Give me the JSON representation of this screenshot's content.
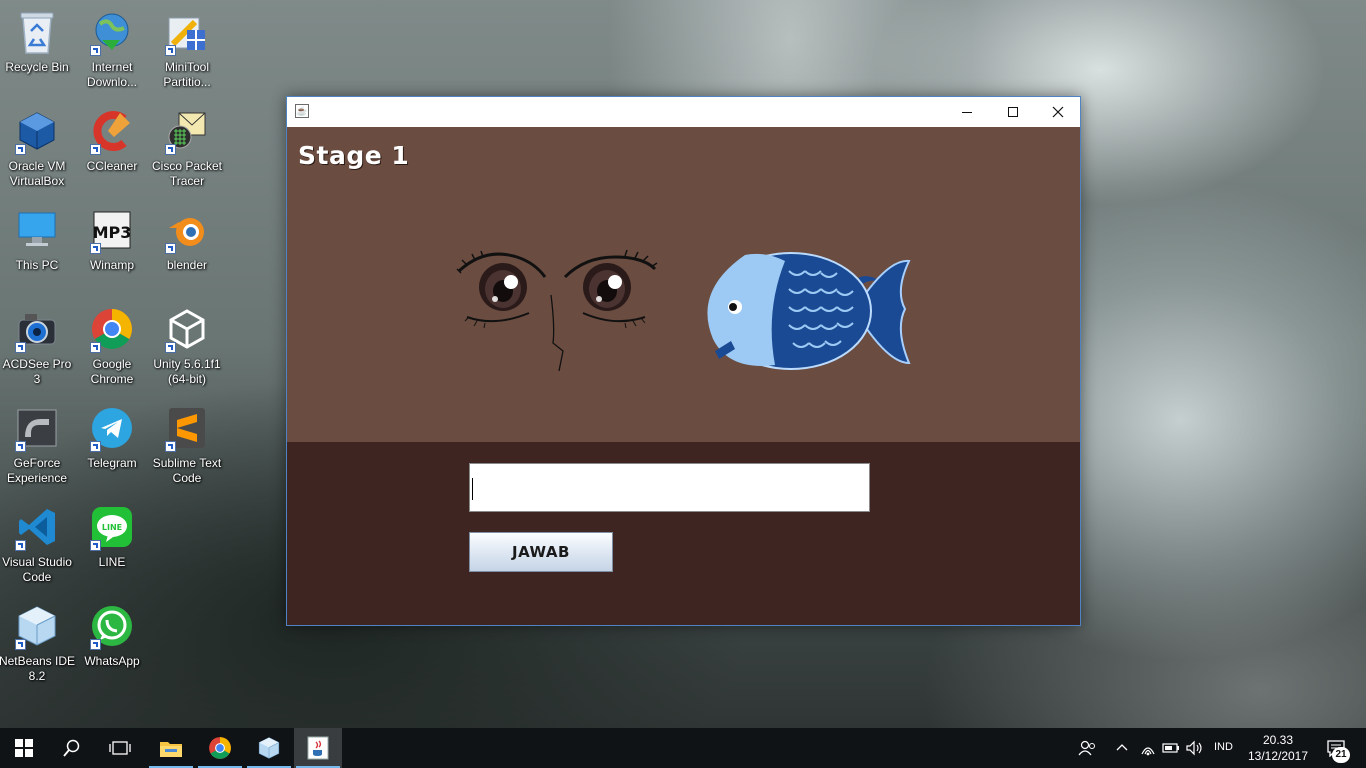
{
  "desktop": {
    "icons": [
      {
        "label": "Recycle Bin"
      },
      {
        "label": "Internet\nDownlo..."
      },
      {
        "label": "MiniTool\nPartitio..."
      },
      {
        "label": "Oracle VM\nVirtualBox"
      },
      {
        "label": "CCleaner"
      },
      {
        "label": "Cisco Packet\nTracer"
      },
      {
        "label": "This PC"
      },
      {
        "label": "Winamp"
      },
      {
        "label": "blender"
      },
      {
        "label": "ACDSee Pro\n3"
      },
      {
        "label": "Google\nChrome"
      },
      {
        "label": "Unity 5.6.1f1\n(64-bit)"
      },
      {
        "label": "GeForce\nExperience"
      },
      {
        "label": "Telegram"
      },
      {
        "label": "Sublime Text\nCode"
      },
      {
        "label": "Visual Studio\nCode"
      },
      {
        "label": "LINE"
      },
      {
        "label": "NetBeans IDE\n8.2"
      },
      {
        "label": "WhatsApp"
      }
    ]
  },
  "window": {
    "title": "",
    "stage_title": "Stage 1",
    "answer_input": {
      "value": "",
      "placeholder": ""
    },
    "submit_label": "JAWAB",
    "colors": {
      "top_panel": "#6b4c40",
      "bottom_panel": "#3e2522"
    }
  },
  "taskbar": {
    "language": "IND",
    "time": "20.33",
    "date": "13/12/2017",
    "notification_count": "21",
    "pinned": [
      "windows-start",
      "search",
      "task-view",
      "file-explorer",
      "google-chrome",
      "netbeans",
      "java-app"
    ]
  }
}
